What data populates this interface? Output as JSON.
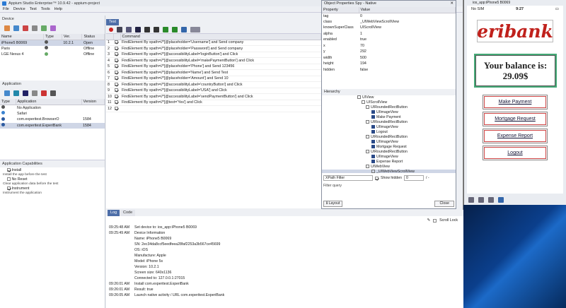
{
  "window": {
    "title": "Appium Studio Enterprise™ 10.9.42 - appium-project"
  },
  "menu": [
    "File",
    "Device",
    "Test",
    "Tools",
    "Help"
  ],
  "device": {
    "section": "Device",
    "headers": [
      "Name",
      "Type",
      "Ver.",
      "Status"
    ],
    "rows": [
      {
        "name": "iPhone5 B0069",
        "ver": "10.2.1",
        "status": "Open"
      },
      {
        "name": "Paris",
        "ver": "",
        "status": "Offline"
      },
      {
        "name": "LGE Nexus 4",
        "ver": "",
        "status": "Offline"
      }
    ]
  },
  "application": {
    "section": "Application",
    "headers": [
      "Type",
      "Application",
      "Version"
    ],
    "rows": [
      {
        "app": "No Application",
        "ver": ""
      },
      {
        "app": "Safari",
        "ver": ""
      },
      {
        "app": "com.experitest.BrowserO",
        "ver": "1584"
      },
      {
        "app": "com.experitest.ExperiBank",
        "ver": "1584"
      }
    ]
  },
  "capabilities": {
    "section": "Application Capabilities",
    "items": [
      {
        "label": "Install",
        "desc": "Install the app before the test",
        "checked": true
      },
      {
        "label": "No Reset",
        "desc": "Clear application data before the test",
        "checked": false
      },
      {
        "label": "Instrument",
        "desc": "Instrument the application",
        "checked": true
      }
    ]
  },
  "test": {
    "tab": "Test",
    "col": "Command",
    "rows": [
      "FindElement By  xpath=//*[@placeholder='Username']  and Send  company",
      "FindElement By  xpath=//*[@placeholder='Password']  and Send  company",
      "FindElement By  xpath=//*[@accessibilityLabel='loginButton']  and Click",
      "FindElement By  xpath=//*[@accessibilityLabel='makePaymentButton']  and Click",
      "FindElement By  xpath=//*[@placeholder='Phone']  and Send  123456",
      "FindElement By  xpath=//*[@placeholder='Name']  and Send  Test",
      "FindElement By  xpath=//*[@placeholder='Amount']  and Send  10",
      "FindElement By  xpath=//*[@accessibilityLabel='countryButton']  and Click",
      "FindElement By  xpath=//*[@accessibilityLabel='USA']  and Click",
      "FindElement By  xpath=//*[@accessibilityLabel='sendPaymentButton']  and Click",
      "FindElement By  xpath=//*[@text='Yes']  and Click",
      ""
    ]
  },
  "spy": {
    "title": "Object Properties Spy - Native",
    "headers": [
      "Property",
      "Value"
    ],
    "props": [
      [
        "tag",
        "0"
      ],
      [
        "class",
        "_UIWebViewScrollView"
      ],
      [
        "knownSuperClass",
        "UIScrollView"
      ],
      [
        "alpha",
        "1"
      ],
      [
        "enabled",
        "true"
      ],
      [
        "x",
        "70"
      ],
      [
        "y",
        "292"
      ],
      [
        "width",
        "500"
      ],
      [
        "height",
        "194"
      ],
      [
        "hidden",
        "false"
      ]
    ],
    "hierarchy_label": "Hierarchy",
    "tree": [
      "UIView",
      "UIScrollView",
      "UIRoundedRectButton",
      "UIImageView",
      "Make Payment",
      "UIRoundedRectButton",
      "UIImageView",
      "Logout",
      "UIRoundedRectButton",
      "UIImageView",
      "Mortgage Request",
      "UIRoundedRectButton",
      "UIImageView",
      "Expense Report",
      "UIWebView",
      "_UIWebViewScrollView"
    ],
    "filter_label": "XPath Filter",
    "show_hidden": "Show hidden",
    "count": "0",
    "count_sep": "/ -",
    "filter_query": "Filter query",
    "layout": "Layout",
    "close": "Close"
  },
  "log": {
    "tabs": [
      "Log",
      "Code"
    ],
    "scroll_lock": "Scroll Lock",
    "lines": [
      [
        "09:25:48 AM",
        "Set device to: ios_app:iPhone5 B0069"
      ],
      [
        "09:25:49 AM",
        "Device Information"
      ],
      [
        "",
        "Name: iPhone5 B0069"
      ],
      [
        "",
        "SN: 2ec34da8ccf5eedfeea28faf2253a3b567ce45699"
      ],
      [
        "",
        "OS: iOS"
      ],
      [
        "",
        "Manufacture: Apple"
      ],
      [
        "",
        "Model: iPhone 5s"
      ],
      [
        "",
        "Version: 10.2.1"
      ],
      [
        "",
        "Screen size: 640x1136"
      ],
      [
        "",
        "Connected to: 127.0.0.1:27015"
      ],
      [
        "09:26:01 AM",
        "Install com.experitest.ExperiBank"
      ],
      [
        "09:26:01 AM",
        "Result: true"
      ],
      [
        "09:26:05 AM",
        "Launch native activity / URL com.experitest.ExperiBank"
      ]
    ]
  },
  "phone": {
    "title": "ios_app:iPhone5 B0069",
    "carrier": "No SIM",
    "time": "9:27",
    "brand": "eribank",
    "balance_line1": "Your balance is:",
    "balance_line2": "29.09$",
    "buttons": [
      "Make Payment",
      "Mortgage Request",
      "Expense Report",
      "Logout"
    ]
  }
}
